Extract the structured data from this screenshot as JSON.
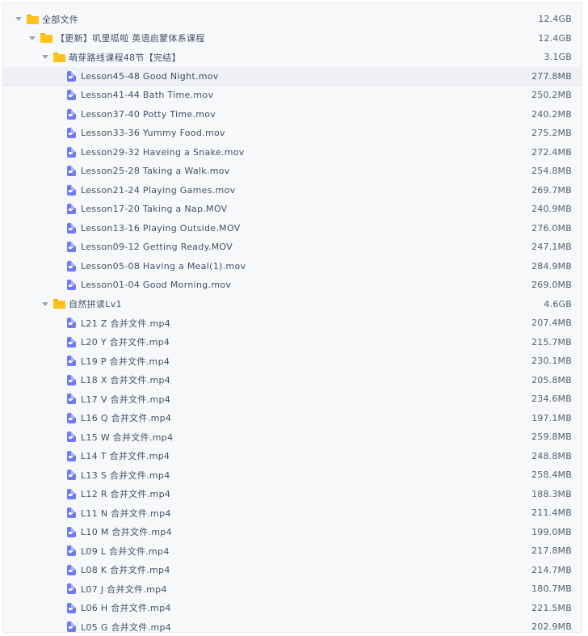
{
  "tree": [
    {
      "level": 0,
      "type": "folder",
      "expanded": true,
      "name": "全部文件",
      "size": "12.4GB"
    },
    {
      "level": 1,
      "type": "folder",
      "expanded": true,
      "name": "【更新】叽里呱啦 英语启蒙体系课程",
      "size": "12.4GB"
    },
    {
      "level": 2,
      "type": "folder",
      "expanded": true,
      "name": "萌芽路线课程48节【完结】",
      "size": "3.1GB"
    },
    {
      "level": 3,
      "type": "video",
      "name": "Lesson45-48 Good Night.mov",
      "size": "277.8MB",
      "highlighted": true
    },
    {
      "level": 3,
      "type": "video",
      "name": "Lesson41-44 Bath Time.mov",
      "size": "250.2MB"
    },
    {
      "level": 3,
      "type": "video",
      "name": "Lesson37-40 Potty Time.mov",
      "size": "240.2MB"
    },
    {
      "level": 3,
      "type": "video",
      "name": "Lesson33-36 Yummy Food.mov",
      "size": "275.2MB"
    },
    {
      "level": 3,
      "type": "video",
      "name": "Lesson29-32 Haveing a Snake.mov",
      "size": "272.4MB"
    },
    {
      "level": 3,
      "type": "video",
      "name": "Lesson25-28 Taking a Walk.mov",
      "size": "254.8MB"
    },
    {
      "level": 3,
      "type": "video",
      "name": "Lesson21-24 Playing Games.mov",
      "size": "269.7MB"
    },
    {
      "level": 3,
      "type": "video",
      "name": "Lesson17-20 Taking a Nap.MOV",
      "size": "240.9MB"
    },
    {
      "level": 3,
      "type": "video",
      "name": "Lesson13-16 Playing Outside.MOV",
      "size": "276.0MB"
    },
    {
      "level": 3,
      "type": "video",
      "name": "Lesson09-12 Getting Ready.MOV",
      "size": "247.1MB"
    },
    {
      "level": 3,
      "type": "video",
      "name": "Lesson05-08 Having a Meal(1).mov",
      "size": "284.9MB"
    },
    {
      "level": 3,
      "type": "video",
      "name": "Lesson01-04 Good Morning.mov",
      "size": "269.0MB"
    },
    {
      "level": 2,
      "type": "folder",
      "expanded": true,
      "name": "自然拼读Lv1",
      "size": "4.6GB"
    },
    {
      "level": 3,
      "type": "video",
      "name": "L21 Z 合并文件.mp4",
      "size": "207.4MB"
    },
    {
      "level": 3,
      "type": "video",
      "name": "L20 Y 合并文件.mp4",
      "size": "215.7MB"
    },
    {
      "level": 3,
      "type": "video",
      "name": "L19 P 合并文件.mp4",
      "size": "230.1MB"
    },
    {
      "level": 3,
      "type": "video",
      "name": "L18 X 合并文件.mp4",
      "size": "205.8MB"
    },
    {
      "level": 3,
      "type": "video",
      "name": "L17 V 合并文件.mp4",
      "size": "234.6MB"
    },
    {
      "level": 3,
      "type": "video",
      "name": "L16 Q 合并文件.mp4",
      "size": "197.1MB"
    },
    {
      "level": 3,
      "type": "video",
      "name": "L15 W 合并文件.mp4",
      "size": "259.8MB"
    },
    {
      "level": 3,
      "type": "video",
      "name": "L14 T 合并文件.mp4",
      "size": "248.8MB"
    },
    {
      "level": 3,
      "type": "video",
      "name": "L13 S 合并文件.mp4",
      "size": "258.4MB"
    },
    {
      "level": 3,
      "type": "video",
      "name": "L12 R 合并文件.mp4",
      "size": "188.3MB"
    },
    {
      "level": 3,
      "type": "video",
      "name": "L11 N 合并文件.mp4",
      "size": "211.4MB"
    },
    {
      "level": 3,
      "type": "video",
      "name": "L10 M 合并文件.mp4",
      "size": "199.0MB"
    },
    {
      "level": 3,
      "type": "video",
      "name": "L09 L 合并文件.mp4",
      "size": "217.8MB"
    },
    {
      "level": 3,
      "type": "video",
      "name": "L08 K 合并文件.mp4",
      "size": "214.7MB"
    },
    {
      "level": 3,
      "type": "video",
      "name": "L07 J 合并文件.mp4",
      "size": "180.7MB"
    },
    {
      "level": 3,
      "type": "video",
      "name": "L06 H 合并文件.mp4",
      "size": "221.5MB"
    },
    {
      "level": 3,
      "type": "video",
      "name": "L05 G 合并文件.mp4",
      "size": "202.9MB"
    }
  ],
  "icons": {
    "folder": "folder-icon",
    "video": "video-file-icon",
    "expand": "caret-down-icon"
  },
  "colors": {
    "folder": "#ffc21a",
    "video": "#6f7bf2",
    "text": "#424e67"
  }
}
